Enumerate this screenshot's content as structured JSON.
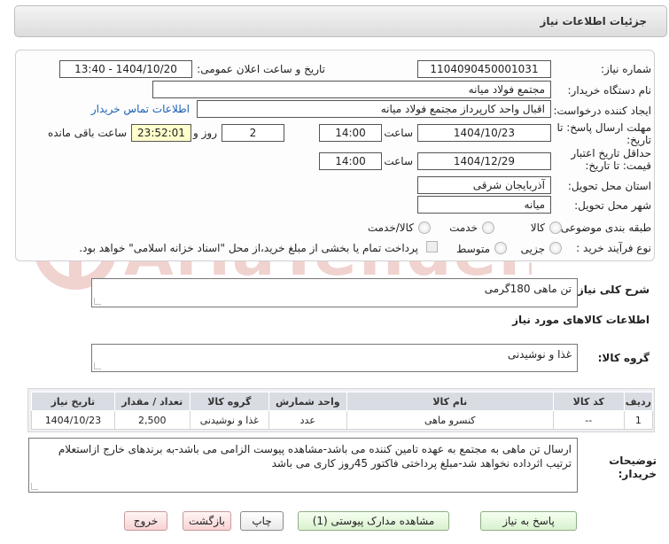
{
  "header": {
    "title": "جزئیات اطلاعات نیاز"
  },
  "form": {
    "need_number_label": "شماره نیاز:",
    "need_number": "1104090450001031",
    "announce_label": "تاریخ و ساعت اعلان عمومی:",
    "announce_value": "1404/10/20 - 13:40",
    "buyer_label": "نام دستگاه خریدار:",
    "buyer_value": "مجتمع فولاد میانه",
    "creator_label": "ایجاد کننده درخواست:",
    "creator_value": "اقبال واحد کارپرداز مجتمع فولاد میانه",
    "contact_link": "اطلاعات تماس خریدار",
    "deadline_label": "مهلت ارسال پاسخ: تا تاریخ:",
    "deadline_date": "1404/10/23",
    "time_label": "ساعت",
    "deadline_time": "14:00",
    "days_value": "2",
    "days_label": "روز و",
    "remaining_value": "23:52:01",
    "remaining_label": "ساعت باقی مانده",
    "validity_label": "حداقل تاریخ اعتبار قیمت: تا تاریخ:",
    "validity_date": "1404/12/29",
    "validity_time": "14:00",
    "province_label": "استان محل تحویل:",
    "province_value": "آذربایجان شرقی",
    "city_label": "شهر محل تحویل:",
    "city_value": "میانه",
    "category_label": "طبقه بندی موضوعی:",
    "category_options": [
      "کالا",
      "خدمت",
      "کالا/خدمت"
    ],
    "process_label": "نوع فرآیند خرید :",
    "process_options": [
      "جزیی",
      "متوسط"
    ],
    "payment_note": "پرداخت تمام یا بخشی از مبلغ خرید،از محل \"اسناد خزانه اسلامی\" خواهد بود."
  },
  "summary": {
    "label": "شرح کلی نیاز:",
    "value": "تن ماهی 180گرمی"
  },
  "goods": {
    "section_title": "اطلاعات کالاهای مورد نیاز",
    "group_label": "گروه کالا:",
    "group_value": "غذا و نوشیدنی",
    "columns": [
      "ردیف",
      "کد کالا",
      "نام کالا",
      "واحد شمارش",
      "گروه کالا",
      "تعداد / مقدار",
      "تاریخ نیاز"
    ],
    "rows": [
      [
        "1",
        "--",
        "کنسرو ماهی",
        "عدد",
        "غذا و نوشیدنی",
        "2,500",
        "1404/10/23"
      ]
    ]
  },
  "notes": {
    "label": "توضیحات خریدار:",
    "value": "ارسال تن ماهی به مجتمع به عهده تامین کننده می باشد-مشاهده پیوست الزامی می باشد-به برندهای خارج ازاستعلام ترتیب اثرداده نخواهد شد-مبلغ پرداختی فاکتور 45روز کاری می باشد"
  },
  "buttons": {
    "reply": "پاسخ به نیاز",
    "attachments": "مشاهده مدارک پیوستی (1)",
    "print": "چاپ",
    "back": "بازگشت",
    "exit": "خروج"
  },
  "watermark": {
    "text": "AriaTender.neT"
  },
  "colors": {
    "link": "#1a5fb4",
    "remaining_bg": "#ffffcc",
    "watermark": "#c0392b"
  }
}
